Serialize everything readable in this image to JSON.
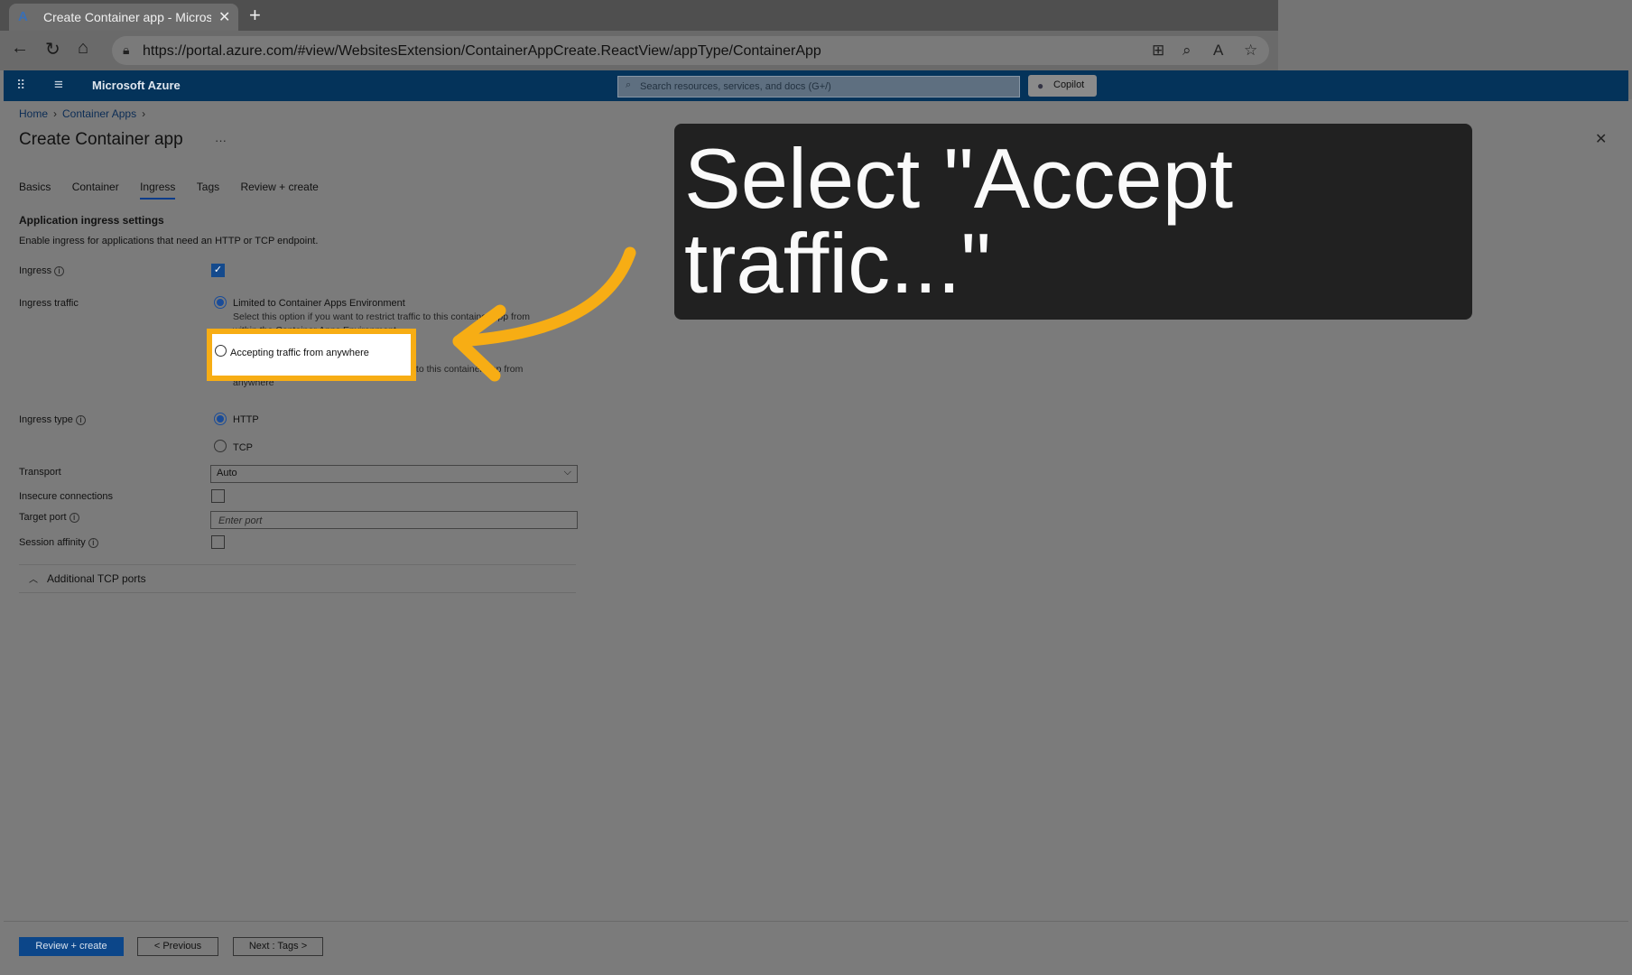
{
  "browser": {
    "tab_title": "Create Container app - Microsoft",
    "url": "https://portal.azure.com/#view/WebsitesExtension/ContainerAppCreate.ReactView/appType/ContainerApp"
  },
  "azure_header": {
    "brand": "Microsoft Azure",
    "search_placeholder": "Search resources, services, and docs (G+/)",
    "copilot_label": "Copilot"
  },
  "breadcrumb": [
    "Home",
    "Container Apps"
  ],
  "page_title": "Create Container app",
  "tabs": [
    "Basics",
    "Container",
    "Ingress",
    "Tags",
    "Review + create"
  ],
  "active_tab": "Ingress",
  "section": {
    "title": "Application ingress settings",
    "description": "Enable ingress for applications that need an HTTP or TCP endpoint."
  },
  "form": {
    "ingress_label": "Ingress",
    "ingress_checked": true,
    "ingress_traffic_label": "Ingress traffic",
    "traffic_options": [
      {
        "label": "Limited to Container Apps Environment",
        "sub": "Select this option if you want to restrict traffic to this container app from within the Container Apps Environment"
      },
      {
        "label": "Accepting traffic from anywhere",
        "sub": "Select this option if you want to allow traffic to this container app from anywhere"
      }
    ],
    "ingress_type_label": "Ingress type",
    "ingress_types": [
      "HTTP",
      "TCP"
    ],
    "transport_label": "Transport",
    "transport_value": "Auto",
    "insecure_label": "Insecure connections",
    "target_port_label": "Target port",
    "target_port_placeholder": "Enter port",
    "session_affinity_label": "Session affinity",
    "additional_tcp_label": "Additional TCP ports"
  },
  "footer": {
    "review_create": "Review + create",
    "previous": "< Previous",
    "next": "Next : Tags >"
  },
  "annotation": {
    "message": "Select \"Accept traffic...\"",
    "highlight_color": "#f7ad14"
  }
}
